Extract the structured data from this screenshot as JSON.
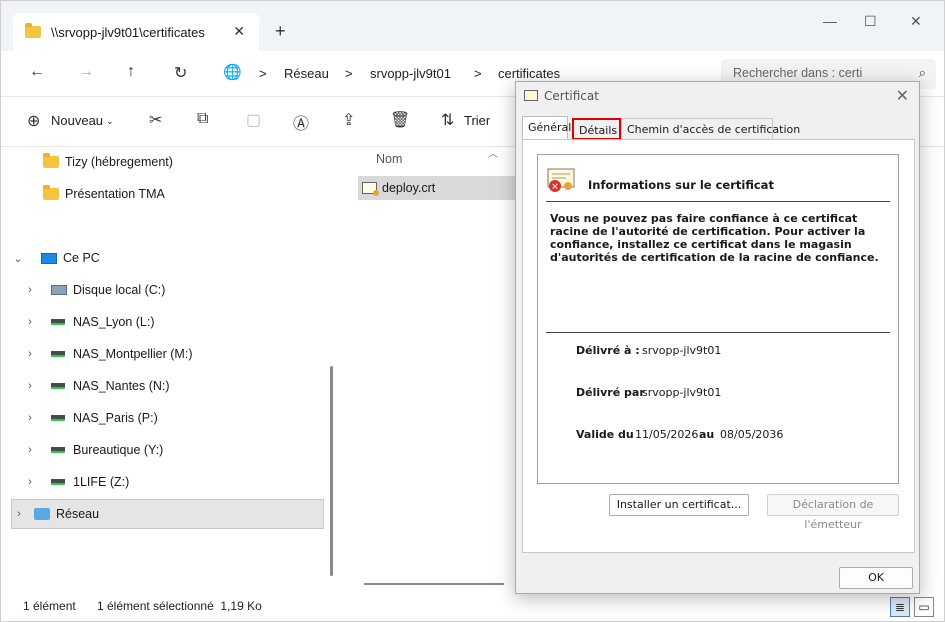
{
  "tab": {
    "title": "\\\\srvopp-jlv9t01\\certificates",
    "close": "✕",
    "new": "+"
  },
  "window": {
    "minimize": "—",
    "maximize": "☐",
    "close": "✕"
  },
  "address": {
    "back": "←",
    "forward": "→",
    "up": "↑",
    "refresh": "↻",
    "crumbs": [
      "Réseau",
      "srvopp-jlv9t01",
      "certificates"
    ],
    "separator": ">",
    "search_placeholder": "Rechercher dans : certi"
  },
  "toolbar": {
    "new_label": "Nouveau",
    "sort_label": "Trier"
  },
  "sidebar": {
    "items": [
      {
        "label": "Tizy (hébregement)"
      },
      {
        "label": "Présentation TMA"
      },
      {
        "label": "Ce PC"
      },
      {
        "label": "Disque local (C:)"
      },
      {
        "label": "NAS_Lyon (L:)"
      },
      {
        "label": "NAS_Montpellier (M:)"
      },
      {
        "label": "NAS_Nantes (N:)"
      },
      {
        "label": "NAS_Paris (P:)"
      },
      {
        "label": "Bureautique (Y:)"
      },
      {
        "label": "1LIFE (Z:)"
      },
      {
        "label": "Réseau"
      }
    ]
  },
  "filelist": {
    "column_name": "Nom",
    "files": [
      {
        "name": "deploy.crt"
      }
    ]
  },
  "status": {
    "count": "1 élément",
    "selection": "1 élément sélectionné  1,19 Ko"
  },
  "dialog": {
    "title": "Certificat",
    "tabs": [
      "Général",
      "Détails",
      "Chemin d'accès de certification"
    ],
    "info_title": "Informations sur le certificat",
    "warning": "Vous ne pouvez pas faire confiance à ce certificat racine de l'autorité de certification. Pour activer la confiance, installez ce certificat dans le magasin d'autorités de certification de la racine de confiance.",
    "issued_to_label": "Délivré à :",
    "issued_to": "srvopp-jlv9t01",
    "issued_by_label": "Délivré par",
    "issued_by": "srvopp-jlv9t01",
    "valid_from_label": "Valide du",
    "valid_from": "11/05/2026",
    "valid_to_label": "au",
    "valid_to": "08/05/2036",
    "install_button": "Installer un certificat...",
    "issuer_statement_button": "Déclaration de l'émetteur",
    "ok_button": "OK"
  }
}
